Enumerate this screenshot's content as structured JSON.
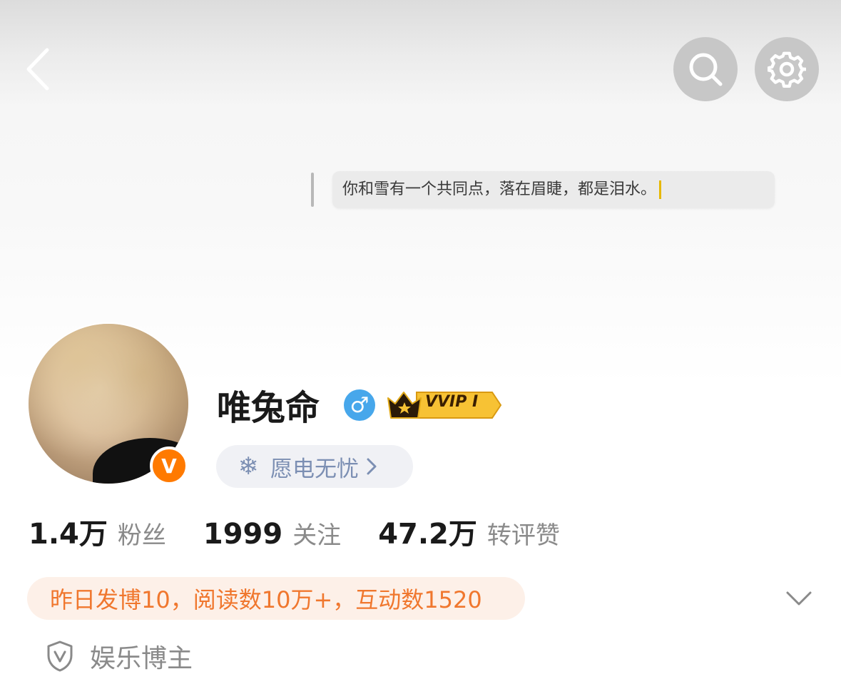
{
  "header": {
    "back_icon": "back-arrow-icon",
    "search_icon": "search-icon",
    "settings_icon": "gear-icon"
  },
  "cover": {
    "quote": "你和雪有一个共同点，落在眉睫，都是泪水。"
  },
  "profile": {
    "username": "唯兔命",
    "gender_symbol": "♂",
    "verified_symbol": "V",
    "vip_label": "VVIP Ⅰ",
    "tag_label": "愿电无忧",
    "tag_icon": "snowflake-icon"
  },
  "stats": [
    {
      "value": "1.4万",
      "label": "粉丝"
    },
    {
      "value": "1999",
      "label": "关注"
    },
    {
      "value": "47.2万",
      "label": "转评赞"
    }
  ],
  "activity": {
    "summary": "昨日发博10，阅读数10万+，互动数1520"
  },
  "category": {
    "label": "娱乐博主",
    "icon": "shield-v-icon"
  },
  "colors": {
    "accent_orange": "#f0772e",
    "activity_bg": "#fdf0e8",
    "verified_orange": "#ff7a00",
    "gender_blue": "#47a7eb",
    "tag_blue_gray": "#7c8fb3",
    "header_button_gray": "#c7c7c7"
  }
}
